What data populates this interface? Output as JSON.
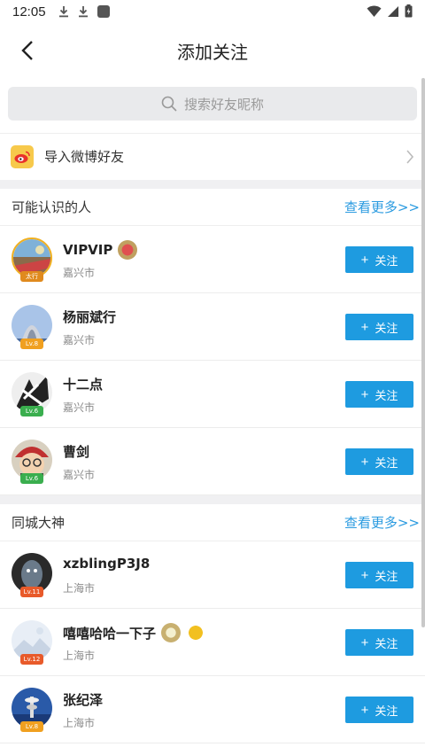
{
  "status": {
    "time": "12:05"
  },
  "header": {
    "title": "添加关注"
  },
  "search": {
    "placeholder": "搜索好友昵称"
  },
  "weibo": {
    "label": "导入微博好友"
  },
  "sections": [
    {
      "title": "可能认识的人",
      "more": "查看更多>>",
      "users": [
        {
          "name": "VIPVIP",
          "city": "嘉兴市",
          "badge": "太行",
          "badge_color": "#e08a1e",
          "follow": "关注"
        },
        {
          "name": "杨丽斌行",
          "city": "嘉兴市",
          "badge": "Lv.8",
          "badge_color": "#f0a020",
          "follow": "关注"
        },
        {
          "name": "十二点",
          "city": "嘉兴市",
          "badge": "Lv.6",
          "badge_color": "#3aae4e",
          "follow": "关注"
        },
        {
          "name": "曹剑",
          "city": "嘉兴市",
          "badge": "Lv.6",
          "badge_color": "#3aae4e",
          "follow": "关注"
        }
      ]
    },
    {
      "title": "同城大神",
      "more": "查看更多>>",
      "users": [
        {
          "name": "xzblingP3J8",
          "city": "上海市",
          "badge": "Lv.11",
          "badge_color": "#e85a2a",
          "follow": "关注"
        },
        {
          "name": "嘻嘻哈哈一下子",
          "city": "上海市",
          "badge": "Lv.12",
          "badge_color": "#e85a2a",
          "follow": "关注"
        },
        {
          "name": "张纪泽",
          "city": "上海市",
          "badge": "Lv.8",
          "badge_color": "#f0a020",
          "follow": "关注"
        }
      ]
    }
  ],
  "colors": {
    "accent": "#1e9be0",
    "link": "#2b9be0",
    "weibo": "#f7c94b"
  }
}
